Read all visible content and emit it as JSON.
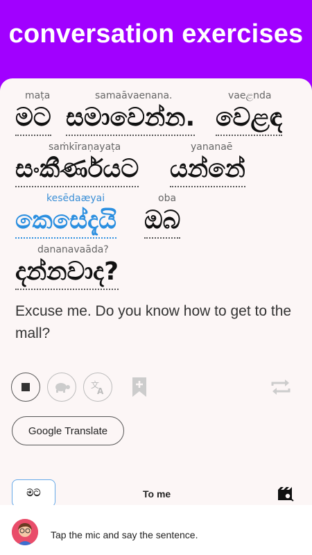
{
  "header": {
    "title": "conversation exercises"
  },
  "sentence": {
    "lines": [
      [
        {
          "tr": "maṭa",
          "si": "මට"
        },
        {
          "tr": "samaāvaenana.",
          "si": "සමාවෙන්න."
        },
        {
          "tr": "vaeළnda",
          "si": "වෙළඳ"
        }
      ],
      [
        {
          "tr": "saṁkīraṇayaṭa",
          "si": "සංකීර්ණයට"
        },
        {
          "tr": "yananaē",
          "si": "යන්නේ"
        }
      ],
      [
        {
          "tr": "kesēdaæyai",
          "si": "කෙසේදැයි",
          "active": true
        },
        {
          "tr": "oba",
          "si": "ඔබ"
        }
      ],
      [
        {
          "tr": "dananavaāda?",
          "si": "දන්නවාද?"
        }
      ]
    ],
    "translation": "Excuse me. Do you know how to get to the mall?"
  },
  "controls": {
    "stop_icon": "stop-icon",
    "slow_icon": "turtle-icon",
    "translate_icon": "translate-icon",
    "bookmark_icon": "bookmark-add-icon",
    "repeat_icon": "repeat-icon",
    "google_translate_label": "Google Translate"
  },
  "vocab": {
    "chip_label": "මට",
    "chip_meaning": "To me",
    "video_icon": "video-search-icon"
  },
  "footer": {
    "avatar": "avatar",
    "prompt": "Tap the mic and say the sentence."
  },
  "colors": {
    "brand": "#a100ff",
    "active_word": "#2b8fe0",
    "card_bg": "#fcf6f6"
  }
}
